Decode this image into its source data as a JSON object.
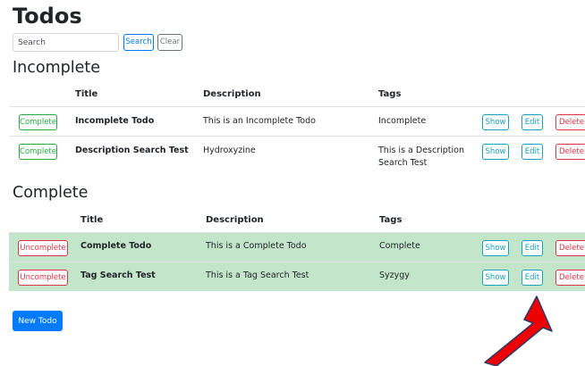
{
  "header": {
    "title": "Todos"
  },
  "search": {
    "placeholder": "Search",
    "search_label": "Search",
    "clear_label": "Clear"
  },
  "columns": {
    "title": "Title",
    "description": "Description",
    "tags": "Tags"
  },
  "incomplete": {
    "heading": "Incomplete",
    "rows": [
      {
        "action": "Complete",
        "title": "Incomplete Todo",
        "description": "This is an Incomplete Todo",
        "tags": "Incomplete",
        "show": "Show",
        "edit": "Edit",
        "delete": "Delete"
      },
      {
        "action": "Complete",
        "title": "Description Search Test",
        "description": "Hydroxyzine",
        "tags": "This is a Description Search Test",
        "show": "Show",
        "edit": "Edit",
        "delete": "Delete"
      }
    ]
  },
  "complete": {
    "heading": "Complete",
    "rows": [
      {
        "action": "Uncomplete",
        "title": "Complete Todo",
        "description": "This is a Complete Todo",
        "tags": "Complete",
        "show": "Show",
        "edit": "Edit",
        "delete": "Delete"
      },
      {
        "action": "Uncomplete",
        "title": "Tag Search Test",
        "description": "This is a Tag Search Test",
        "tags": "Syzygy",
        "show": "Show",
        "edit": "Edit",
        "delete": "Delete"
      }
    ]
  },
  "footer": {
    "new_todo_label": "New Todo"
  },
  "colors": {
    "primary": "#007bff",
    "success": "#28a745",
    "danger": "#dc3545",
    "info": "#17a2b8",
    "complete_row_bg": "#c3e6cb",
    "annotation_arrow": "#ee0000"
  },
  "annotation": {
    "icon": "red-arrow-icon"
  }
}
